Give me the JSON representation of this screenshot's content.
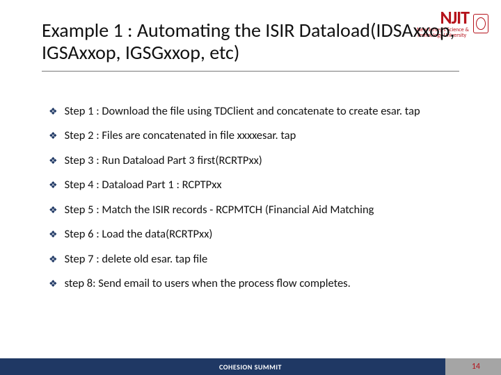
{
  "logo": {
    "brand": "NJIT",
    "tagline_line1": "New Jersey's Science &",
    "tagline_line2": "Technology University"
  },
  "title": "Example 1 : Automating the ISIR Dataload(IDSAxxop, IGSAxxop, IGSGxxop, etc)",
  "bullets": [
    "Step 1 : Download the file using TDClient and concatenate to create esar. tap",
    "Step 2 : Files are concatenated in file xxxxesar. tap",
    "Step 3 : Run Dataload Part 3 first(RCRTPxx)",
    "Step 4 : Dataload Part 1 : RCPTPxx",
    "Step 5 :  Match the ISIR records - RCPMTCH (Financial Aid Matching",
    "Step 6 : Load the data(RCRTPxx)",
    "Step 7 : delete old esar. tap file",
    "step 8: Send email to users when the process flow completes."
  ],
  "footer": {
    "label": "COHESION SUMMIT",
    "page_number": "14"
  }
}
